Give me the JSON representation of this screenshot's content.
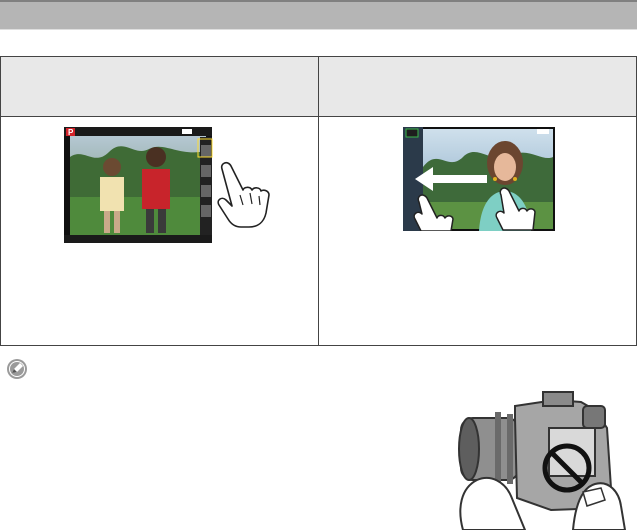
{
  "page": {
    "header_bar_color": "#b5b5b5",
    "table_header_color": "#e8e8e8"
  },
  "table": {
    "columns": [
      {
        "header": "",
        "image": "camera-lcd-touch-gesture-photo",
        "body_text": ""
      },
      {
        "header": "",
        "image": "camera-lcd-slide-gesture-photo",
        "body_text": ""
      }
    ]
  },
  "note": {
    "icon": "note-pencil-icon",
    "text": ""
  },
  "illustration": {
    "icon": "camera-do-not-touch-lens-icon",
    "prohibit_color": "#111111"
  }
}
